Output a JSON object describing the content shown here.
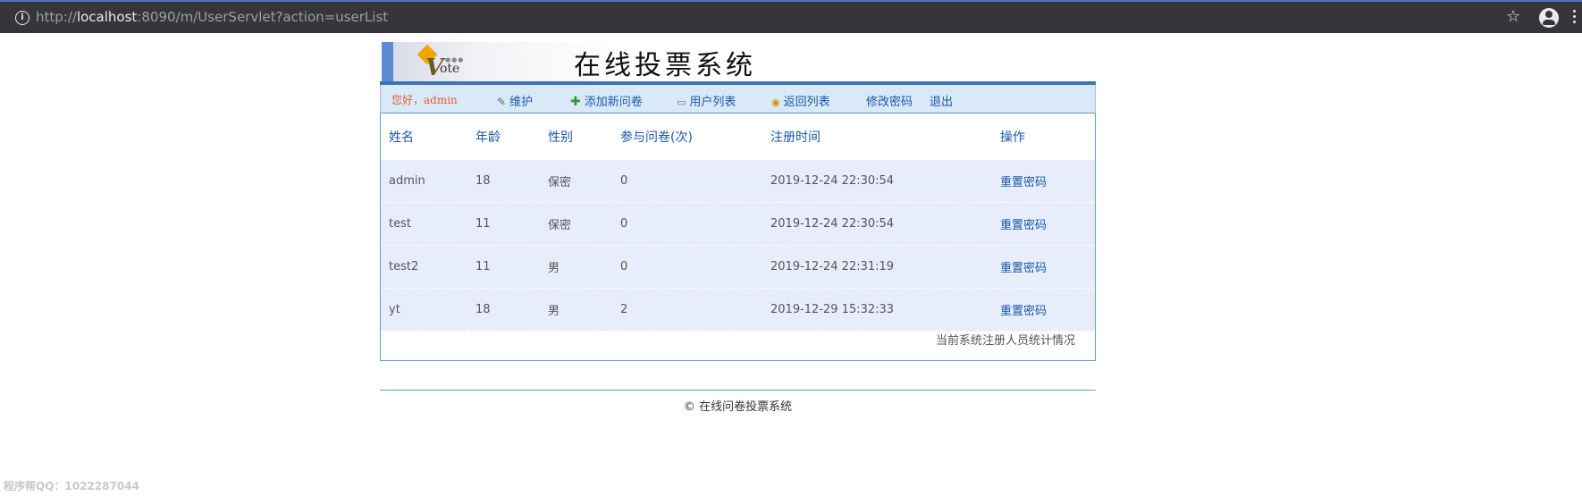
{
  "browser": {
    "url_prefix": "http://",
    "url_host": "localhost",
    "url_rest": ":8090/m/UserServlet?action=userList"
  },
  "banner": {
    "logo_v": "V",
    "logo_ote": "ote",
    "logo_dots": "●●●",
    "title": "在线投票系统"
  },
  "nav": {
    "greeting": "您好，admin",
    "items": [
      {
        "label": "维护",
        "icon": "wrench-icon"
      },
      {
        "label": "添加新问卷",
        "icon": "plus-icon"
      },
      {
        "label": "用户列表",
        "icon": "chat-icon"
      },
      {
        "label": "返回列表",
        "icon": "return-icon"
      },
      {
        "label": "修改密码",
        "icon": ""
      },
      {
        "label": "退出",
        "icon": ""
      }
    ]
  },
  "table": {
    "headers": [
      "姓名",
      "年龄",
      "性别",
      "参与问卷(次)",
      "注册时间",
      "操作"
    ],
    "rows": [
      {
        "name": "admin",
        "age": "18",
        "gender": "保密",
        "count": "0",
        "registered": "2019-12-24 22:30:54",
        "action": "重置密码"
      },
      {
        "name": "test",
        "age": "11",
        "gender": "保密",
        "count": "0",
        "registered": "2019-12-24 22:30:54",
        "action": "重置密码"
      },
      {
        "name": "test2",
        "age": "11",
        "gender": "男",
        "count": "0",
        "registered": "2019-12-24 22:31:19",
        "action": "重置密码"
      },
      {
        "name": "yt",
        "age": "18",
        "gender": "男",
        "count": "2",
        "registered": "2019-12-29 15:32:33",
        "action": "重置密码"
      }
    ],
    "summary": "当前系统注册人员统计情况"
  },
  "footer": {
    "copyright_symbol": "©",
    "text": "在线问卷投票系统"
  },
  "watermark": "程序帮QQ：1022287044",
  "colors": {
    "accent_blue": "#1a58a8",
    "row_bg": "#e8edfc",
    "nav_bg": "#dae9f8",
    "greeting": "#e06030"
  }
}
